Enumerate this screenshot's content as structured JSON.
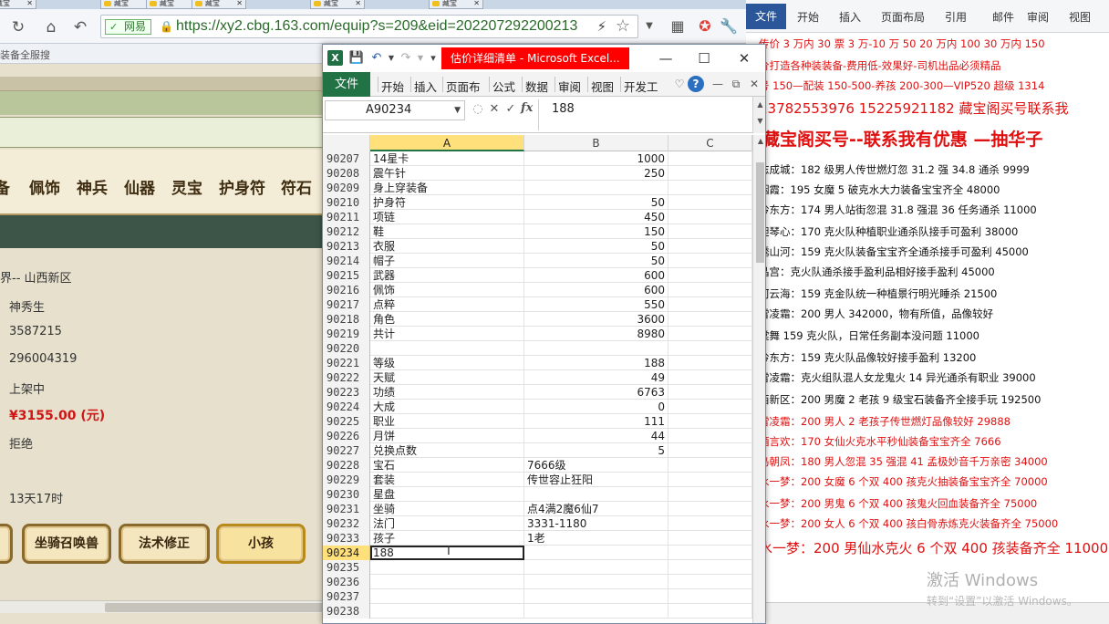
{
  "browser": {
    "tabs": [
      {
        "label": "藏宝"
      },
      {
        "label": "藏宝"
      },
      {
        "label": "藏宝"
      },
      {
        "label": "藏宝"
      },
      {
        "label": "藏宝"
      },
      {
        "label": "藏宝"
      }
    ],
    "security_label": "网易",
    "url": "https://xy2.cbg.163.com/equip?s=209&eid=202207292200213",
    "favbar_text": "装备全服搜",
    "categories": [
      "备",
      "佩饰",
      "神兵",
      "仙器",
      "灵宝",
      "护身符",
      "符石"
    ],
    "info": {
      "server": "界-- 山西新区",
      "name": "神秀生",
      "id1": "3587215",
      "id2": "296004319",
      "status": "上架中",
      "price": "¥3155.00 (元)",
      "bargain": "拒绝",
      "time_left": "13天17时"
    },
    "bottom_buttons": [
      "坐骑召唤兽",
      "法术修正",
      "小孩"
    ]
  },
  "excel": {
    "title": "估价详细清单 - Microsoft Excel...",
    "ribbon_file": "文件",
    "ribbon_tabs": [
      "开始",
      "插入",
      "页面布",
      "公式",
      "数据",
      "审阅",
      "视图",
      "开发工"
    ],
    "name_box": "A90234",
    "fx": "fx",
    "formula_value": "188",
    "columns": [
      "A",
      "B",
      "C"
    ],
    "rows": [
      {
        "n": "90207",
        "a": "14星卡",
        "b": "1000",
        "num": true
      },
      {
        "n": "90208",
        "a": "震午针",
        "b": "250",
        "num": true
      },
      {
        "n": "90209",
        "a": "身上穿装备",
        "b": "",
        "num": true
      },
      {
        "n": "90210",
        "a": "护身符",
        "b": "50",
        "num": true
      },
      {
        "n": "90211",
        "a": "项链",
        "b": "450",
        "num": true
      },
      {
        "n": "90212",
        "a": "鞋",
        "b": "150",
        "num": true
      },
      {
        "n": "90213",
        "a": "衣服",
        "b": "50",
        "num": true
      },
      {
        "n": "90214",
        "a": "帽子",
        "b": "50",
        "num": true
      },
      {
        "n": "90215",
        "a": "武器",
        "b": "600",
        "num": true
      },
      {
        "n": "90216",
        "a": "佩饰",
        "b": "600",
        "num": true
      },
      {
        "n": "90217",
        "a": "点粹",
        "b": "550",
        "num": true
      },
      {
        "n": "90218",
        "a": "角色",
        "b": "3600",
        "num": true
      },
      {
        "n": "90219",
        "a": "共计",
        "b": "8980",
        "num": true
      },
      {
        "n": "90220",
        "a": "",
        "b": "",
        "num": true
      },
      {
        "n": "90221",
        "a": "等级",
        "b": "188",
        "num": true
      },
      {
        "n": "90222",
        "a": "天赋",
        "b": "49",
        "num": true
      },
      {
        "n": "90223",
        "a": "功绩",
        "b": "6763",
        "num": true
      },
      {
        "n": "90224",
        "a": "大成",
        "b": "0",
        "num": true
      },
      {
        "n": "90225",
        "a": "职业",
        "b": "111",
        "num": true
      },
      {
        "n": "90226",
        "a": "月饼",
        "b": "44",
        "num": true
      },
      {
        "n": "90227",
        "a": "兑换点数",
        "b": "5",
        "num": true
      },
      {
        "n": "90228",
        "a": "宝石",
        "b": "7666级",
        "num": false
      },
      {
        "n": "90229",
        "a": "套装",
        "b": "传世容止狂阳",
        "num": false
      },
      {
        "n": "90230",
        "a": "星盘",
        "b": "",
        "num": false
      },
      {
        "n": "90231",
        "a": "坐骑",
        "b": "点4满2魔6仙7",
        "num": false
      },
      {
        "n": "90232",
        "a": "法门",
        "b": "3331-1180",
        "num": false
      },
      {
        "n": "90233",
        "a": "孩子",
        "b": "1老",
        "num": false
      },
      {
        "n": "90234",
        "a": "188",
        "b": "",
        "num": false,
        "active": true
      },
      {
        "n": "90235",
        "a": "",
        "b": "",
        "num": false
      },
      {
        "n": "90236",
        "a": "",
        "b": "",
        "num": false
      },
      {
        "n": "90237",
        "a": "",
        "b": "",
        "num": false
      },
      {
        "n": "90238",
        "a": "",
        "b": "",
        "num": false
      }
    ]
  },
  "word": {
    "ribbon_file": "文件",
    "ribbon_tabs": [
      "开始",
      "插入",
      "页面布局",
      "引用",
      "邮件",
      "审阅",
      "视图"
    ],
    "lines": [
      {
        "t": "传价 3 万内 30 票  3 万-10 万 50 20 万内 100 30 万内 150",
        "cls": "red"
      },
      {
        "t": "价打造各种装装备-费用低-效果好-司机出品必须精品",
        "cls": "red"
      },
      {
        "t": "号 150—配装 150-500-养孩 200-300—VIP520 超级 1314",
        "cls": "red"
      },
      {
        "t": "13782553976    15225921182  藏宝阁买号联系我",
        "cls": "red big"
      },
      {
        "t": "藏宝阁买号--联系我有优惠 —抽华子",
        "cls": "huge"
      },
      {
        "t": "志成城：182 级男人传世燃灯忽 31.2 强 34.8 通杀 9999",
        "cls": ""
      },
      {
        "t": "烟霞：195 女魔 5 破克水大力装备宝宝齐全 48000",
        "cls": ""
      },
      {
        "t": "吟东方：174 男人站街忽混 31.8 强混 36 任务通杀 11000",
        "cls": ""
      },
      {
        "t": "胆琴心：170 克火队种植职业通杀队接手可盈利 38000",
        "cls": ""
      },
      {
        "t": "绣山河：159 克火队装备宝宝齐全通杀接手可盈利 45000",
        "cls": ""
      },
      {
        "t": "晶宫：克火队通杀接手盈利品相好接手盈利 45000",
        "cls": ""
      },
      {
        "t": "河云海：159 克金队统一种植景行明光睡杀 21500",
        "cls": ""
      },
      {
        "t": "雪凌霜：200 男人 342000，物有所值，品像较好",
        "cls": ""
      },
      {
        "t": "棠舞 159 克火队，日常任务副本没问题 11000",
        "cls": ""
      },
      {
        "t": "吟东方：159 克火队品像较好接手盈利 13200",
        "cls": ""
      },
      {
        "t": "雪凌霜：克火组队混人女龙鬼火 14 异光通杀有职业 39000",
        "cls": ""
      },
      {
        "t": "西新区：200 男魔 2 老孩 9 级宝石装备齐全接手玩 192500",
        "cls": ""
      },
      {
        "t": "雪凌霜：200 男人 2 老孩子传世燃灯品像较好 29888",
        "cls": "red"
      },
      {
        "t": "酒言欢：170 女仙火克水平秒仙装备宝宝齐全 7666",
        "cls": "red"
      },
      {
        "t": "鸟朝凤：180 男人忽混 35 强混 41 孟极妙音千万亲密 34000",
        "cls": "red"
      },
      {
        "t": "水一梦：200 女魔 6 个双 400 孩克火抽装备宝宝齐全 70000",
        "cls": "red"
      },
      {
        "t": "水一梦：200 男鬼 6 个双 400 孩鬼火回血装备齐全 75000",
        "cls": "red"
      },
      {
        "t": "水一梦：200 女人 6 个双 400 孩白骨赤炼克火装备齐全 75000",
        "cls": "red"
      },
      {
        "t": "水一梦：200 男仙水克火 6 个双 400 孩装备齐全 110000",
        "cls": "red big"
      }
    ],
    "watermark_1": "激活 Windows",
    "watermark_2": "转到“设置”以激活 Windows。"
  }
}
